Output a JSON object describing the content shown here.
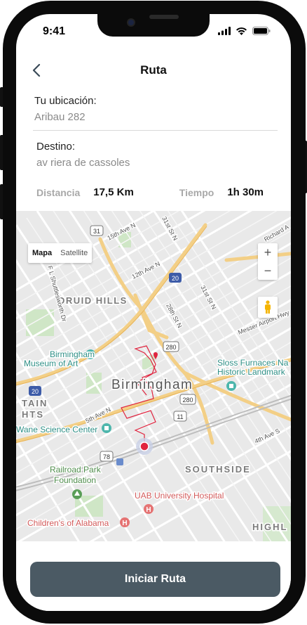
{
  "status_bar": {
    "time": "9:41"
  },
  "nav": {
    "title": "Ruta"
  },
  "origin": {
    "label": "Tu ubicación:",
    "value": "Aribau 282"
  },
  "destination": {
    "label": "Destino:",
    "value": "av riera de cassoles"
  },
  "stats": {
    "distance_label": "Distancia",
    "distance_value": "17,5 Km",
    "time_label": "Tiempo",
    "time_value": "1h 30m"
  },
  "map": {
    "type_toggle": {
      "map": "Mapa",
      "satellite": "Satellite"
    },
    "zoom_in": "+",
    "zoom_out": "−",
    "labels": {
      "druid_hills": "DRUID HILLS",
      "birmingham": "Birmingham",
      "southside": "SOUTHSIDE",
      "highl": "HIGHL",
      "tain": "TAIN",
      "hts": "HTS",
      "museum_1": "Birmingham",
      "museum_2": "Museum of Art",
      "sloss_1": "Sloss Furnaces Na",
      "sloss_2": "Historic Landmark",
      "science": "Wane Science Center",
      "railroad_1": "Railroad Park",
      "railroad_2": "Foundation",
      "uab": "UAB University Hospital",
      "childrens": "Children's of Alabama",
      "st_15th": "15th Ave N",
      "st_12th": "12th Ave N",
      "st_5th": "5th Ave N",
      "st_4th_s": "4th Ave S",
      "st_31st": "31st St N",
      "st_28th": "28th St N",
      "st_31st_b": "31st St N",
      "st_richard": "Richard A",
      "st_messer": "Messer Airport Hwy",
      "st_shuttlesworth": "F L Shuttlesworth Dr",
      "sh_31": "31",
      "sh_20a": "20",
      "sh_20b": "20",
      "sh_280a": "280",
      "sh_280b": "280",
      "sh_11": "11",
      "sh_78": "78"
    },
    "colors": {
      "route": "#e0243f",
      "origin_pin": "#e0243f"
    }
  },
  "cta": {
    "label": "Iniciar Ruta"
  }
}
